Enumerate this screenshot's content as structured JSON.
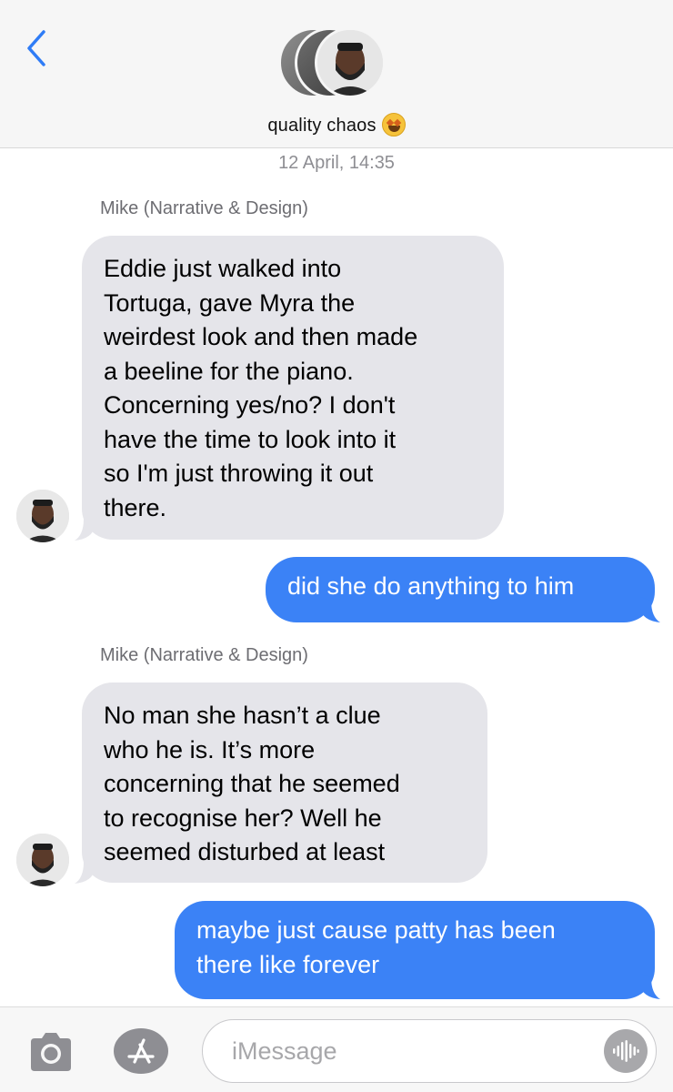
{
  "header": {
    "back_icon": "chevron-left-icon",
    "group_name": "quality chaos",
    "group_emoji": "star-struck-emoji"
  },
  "thread": {
    "timestamp": "12 April, 14:35",
    "messages": [
      {
        "direction": "incoming",
        "sender": "Mike (Narrative & Design)",
        "lines": [
          "Eddie just walked into",
          "Tortuga, gave Myra the",
          "weirdest look and then made",
          "a beeline for the piano.",
          "Concerning yes/no? I don't",
          "have the time to look into it",
          "so I'm just throwing it out",
          "there."
        ]
      },
      {
        "direction": "outgoing",
        "lines": [
          "did she do anything to him"
        ]
      },
      {
        "direction": "incoming",
        "sender": "Mike (Narrative & Design)",
        "lines": [
          "No man she hasn’t a clue",
          "who he is. It’s more",
          "concerning that he seemed",
          "to recognise her? Well he",
          "seemed disturbed at least"
        ]
      },
      {
        "direction": "outgoing",
        "lines": [
          "maybe just cause patty has been",
          "there like forever"
        ]
      }
    ]
  },
  "input_bar": {
    "placeholder": "iMessage",
    "camera_icon": "camera-icon",
    "apps_icon": "app-store-icon",
    "audio_icon": "audio-waveform-icon"
  },
  "colors": {
    "accent": "#3b82f6",
    "incoming_bubble": "#e5e5ea",
    "header_bg": "#f6f6f6",
    "back_chevron": "#2f7cf6"
  }
}
